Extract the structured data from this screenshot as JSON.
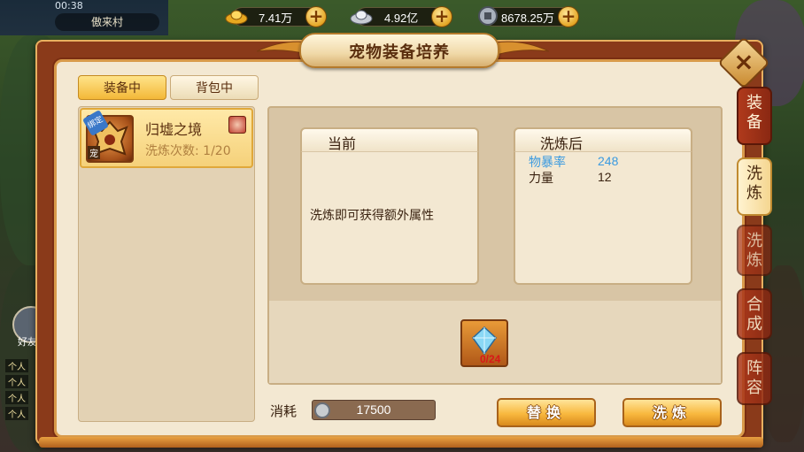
{
  "status_bar": {
    "time": "00:38"
  },
  "location": "傲来村",
  "currency": {
    "gold": "7.41万",
    "silver": "4.92亿",
    "coins": "8678.25万"
  },
  "panel": {
    "title": "宠物装备培养"
  },
  "left_tabs": {
    "equipped": "装备中",
    "backpack": "背包中"
  },
  "item": {
    "name": "归墟之境",
    "refine_count": "洗炼次数: 1/20",
    "bind_badge": "绑定",
    "pet_tag": "宠"
  },
  "current": {
    "title": "当前",
    "empty_hint": "洗炼即可获得额外属性"
  },
  "after": {
    "title": "洗炼后",
    "attributes": [
      {
        "name": "物暴率",
        "value": "248",
        "color": "#3a9ae0"
      },
      {
        "name": "力量",
        "value": "12",
        "color": "#3a2210"
      }
    ]
  },
  "material": {
    "count": "0/24",
    "color": "#d81818"
  },
  "cost": {
    "label": "消耗",
    "value": "17500"
  },
  "buttons": {
    "replace": "替换",
    "refine": "洗炼"
  },
  "side_tabs": [
    {
      "label": "装备",
      "active": false
    },
    {
      "label": "洗炼",
      "active": true
    },
    {
      "label": "洗炼",
      "active": false
    },
    {
      "label": "合成",
      "active": false
    },
    {
      "label": "阵容",
      "active": false
    }
  ],
  "background": {
    "friend_label": "好友",
    "chat_tag": "个人"
  },
  "colors": {
    "accent": "#f3b838",
    "panel_border": "#8a3a1a",
    "panel_bg": "#f3e8d2"
  }
}
